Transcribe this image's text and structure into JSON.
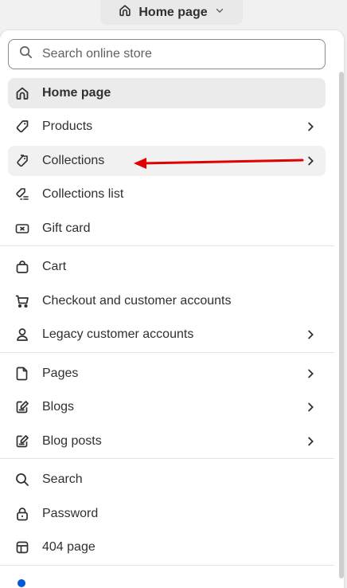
{
  "header": {
    "selector_label": "Home page"
  },
  "search": {
    "placeholder": "Search online store"
  },
  "menu": {
    "home": {
      "label": "Home page",
      "active": true
    },
    "products": {
      "label": "Products"
    },
    "collections": {
      "label": "Collections"
    },
    "collections_list": {
      "label": "Collections list"
    },
    "gift_card": {
      "label": "Gift card"
    },
    "cart": {
      "label": "Cart"
    },
    "checkout": {
      "label": "Checkout and customer accounts"
    },
    "legacy_accounts": {
      "label": "Legacy customer accounts"
    },
    "pages": {
      "label": "Pages"
    },
    "blogs": {
      "label": "Blogs"
    },
    "blog_posts": {
      "label": "Blog posts"
    },
    "search": {
      "label": "Search"
    },
    "password": {
      "label": "Password"
    },
    "not_found": {
      "label": "404 page"
    }
  },
  "colors": {
    "annotation_arrow": "#e00000",
    "active_bg": "#ebebeb"
  }
}
